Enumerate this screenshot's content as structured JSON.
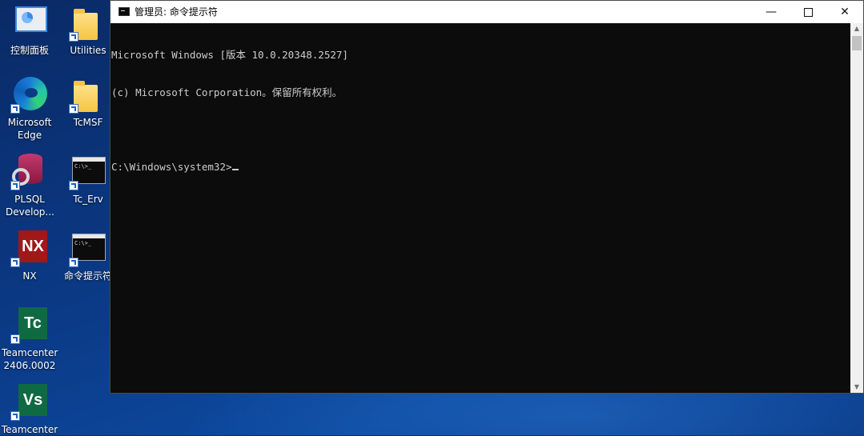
{
  "desktop": {
    "icons": [
      {
        "label": "控制面板"
      },
      {
        "label": "Utilities"
      },
      {
        "label": "Microsoft Edge"
      },
      {
        "label": "TcMSF"
      },
      {
        "label": "PLSQL Develop..."
      },
      {
        "label": "Tc_Erv"
      },
      {
        "label": "NX",
        "tile_text": "NX"
      },
      {
        "label": "命令提示符"
      },
      {
        "label": "Teamcenter 2406.0002",
        "tile_text": "Tc"
      },
      {
        "label": "Teamcenter",
        "tile_text": "Vs"
      }
    ],
    "cmd_thumb_text": "C:\\>_"
  },
  "window": {
    "title": "管理员: 命令提示符",
    "minimize_glyph": "—",
    "close_glyph": "✕",
    "console_lines": [
      "Microsoft Windows [版本 10.0.20348.2527]",
      "(c) Microsoft Corporation。保留所有权利。",
      "",
      "C:\\Windows\\system32>"
    ]
  },
  "scrollbar": {
    "up_glyph": "▲",
    "down_glyph": "▼"
  },
  "colors": {
    "console_bg": "#0c0c0c",
    "console_text": "#cccccc",
    "nx_tile": "#a01818",
    "tc_tile": "#0f6a43",
    "vs_tile": "#0f6a43"
  }
}
